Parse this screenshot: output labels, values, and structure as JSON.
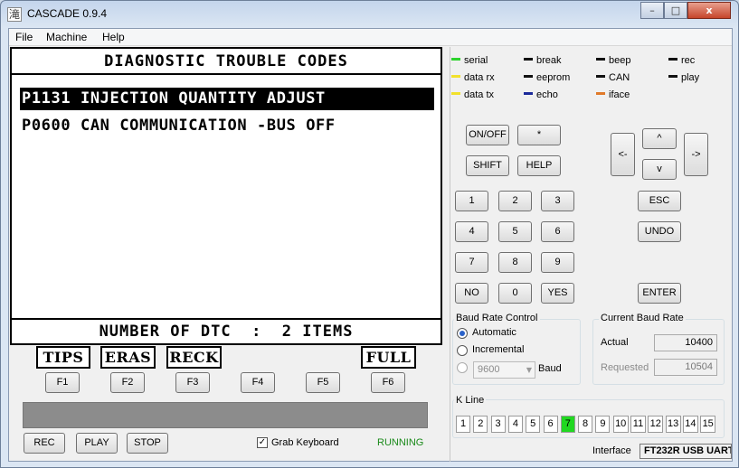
{
  "window": {
    "title": "CASCADE 0.9.4",
    "icon_char": "滝",
    "controls": {
      "minimize": "–",
      "maximize": "□",
      "close": "x"
    }
  },
  "menu": [
    "File",
    "Machine",
    "Help"
  ],
  "lcd": {
    "title": "DIAGNOSTIC TROUBLE CODES",
    "codes": [
      "P1131 INJECTION QUANTITY ADJUST",
      "P0600 CAN COMMUNICATION -BUS OFF"
    ],
    "selected_index": 0,
    "footer": "NUMBER OF DTC  :  2 ITEMS",
    "softkeys": [
      "TIPS",
      "ERAS",
      "RECK",
      "",
      "",
      "FULL"
    ]
  },
  "fkeys": [
    "F1",
    "F2",
    "F3",
    "F4",
    "F5",
    "F6"
  ],
  "bottom": {
    "rec": "REC",
    "play": "PLAY",
    "stop": "STOP",
    "grab_keyboard": "Grab Keyboard",
    "grab_checked": true,
    "status": "RUNNING"
  },
  "leds": [
    {
      "label": "serial",
      "color": "#2ed22e"
    },
    {
      "label": "data rx",
      "color": "#f2e12c"
    },
    {
      "label": "data tx",
      "color": "#f2e12c"
    },
    {
      "label": "break",
      "color": "#111111"
    },
    {
      "label": "eeprom",
      "color": "#111111"
    },
    {
      "label": "echo",
      "color": "#1b2a9a"
    },
    {
      "label": "beep",
      "color": "#111111"
    },
    {
      "label": "CAN",
      "color": "#111111"
    },
    {
      "label": "iface",
      "color": "#e07a2a"
    },
    {
      "label": "rec",
      "color": "#111111"
    },
    {
      "label": "play",
      "color": "#111111"
    }
  ],
  "keypad": {
    "onoff": "ON/OFF",
    "star": "*",
    "shift": "SHIFT",
    "help": "HELP",
    "left": "<-",
    "up": "^",
    "right": "->",
    "down": "v",
    "digits": [
      "1",
      "2",
      "3",
      "4",
      "5",
      "6",
      "7",
      "8",
      "9"
    ],
    "no": "NO",
    "zero": "0",
    "yes": "YES",
    "esc": "ESC",
    "undo": "UNDO",
    "enter": "ENTER"
  },
  "baud_control": {
    "title": "Baud Rate Control",
    "automatic": "Automatic",
    "incremental": "Incremental",
    "rate": "9600",
    "baud_label": "Baud",
    "selected": "Automatic"
  },
  "current_baud": {
    "title": "Current Baud Rate",
    "actual_label": "Actual",
    "actual": "10400",
    "requested_label": "Requested",
    "requested": "10504"
  },
  "kline": {
    "title": "K Line",
    "lines": [
      "1",
      "2",
      "3",
      "4",
      "5",
      "6",
      "7",
      "8",
      "9",
      "10",
      "11",
      "12",
      "13",
      "14",
      "15"
    ],
    "active": "7"
  },
  "interface": {
    "label": "Interface",
    "value": "FT232R USB UART"
  }
}
